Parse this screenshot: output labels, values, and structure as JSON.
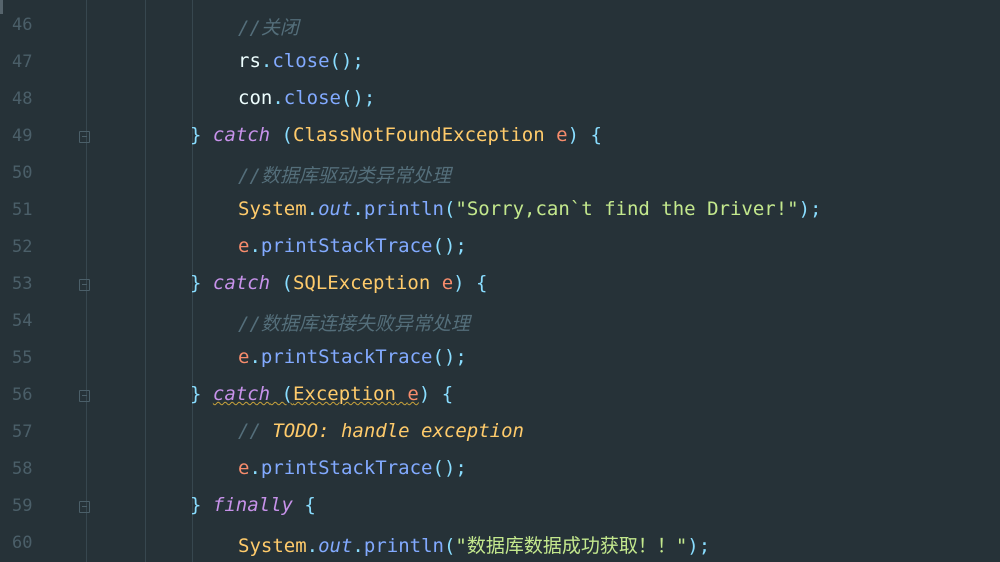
{
  "editor": {
    "lines": [
      {
        "num": "46",
        "indent": 2,
        "tokens": [
          {
            "t": "comment",
            "v": "//关闭"
          }
        ]
      },
      {
        "num": "47",
        "indent": 2,
        "tokens": [
          {
            "t": "plain",
            "v": "rs"
          },
          {
            "t": "punc",
            "v": "."
          },
          {
            "t": "method",
            "v": "close"
          },
          {
            "t": "punc",
            "v": "();"
          }
        ]
      },
      {
        "num": "48",
        "indent": 2,
        "tokens": [
          {
            "t": "plain",
            "v": "con"
          },
          {
            "t": "punc",
            "v": "."
          },
          {
            "t": "method",
            "v": "close"
          },
          {
            "t": "punc",
            "v": "();"
          }
        ]
      },
      {
        "num": "49",
        "indent": 1,
        "fold": true,
        "tokens": [
          {
            "t": "punc",
            "v": "} "
          },
          {
            "t": "kw",
            "v": "catch"
          },
          {
            "t": "punc",
            "v": " ("
          },
          {
            "t": "cls",
            "v": "ClassNotFoundException"
          },
          {
            "t": "plain",
            "v": " "
          },
          {
            "t": "param",
            "v": "e"
          },
          {
            "t": "punc",
            "v": ") {"
          }
        ]
      },
      {
        "num": "50",
        "indent": 2,
        "tokens": [
          {
            "t": "comment",
            "v": "//数据库驱动类异常处理"
          }
        ]
      },
      {
        "num": "51",
        "indent": 2,
        "tokens": [
          {
            "t": "cls",
            "v": "System"
          },
          {
            "t": "punc",
            "v": "."
          },
          {
            "t": "field",
            "v": "out"
          },
          {
            "t": "punc",
            "v": "."
          },
          {
            "t": "method",
            "v": "println"
          },
          {
            "t": "punc",
            "v": "("
          },
          {
            "t": "str",
            "v": "\"Sorry,can`t find the Driver!\""
          },
          {
            "t": "punc",
            "v": ");"
          }
        ]
      },
      {
        "num": "52",
        "indent": 2,
        "tokens": [
          {
            "t": "param",
            "v": "e"
          },
          {
            "t": "punc",
            "v": "."
          },
          {
            "t": "method",
            "v": "printStackTrace"
          },
          {
            "t": "punc",
            "v": "();"
          }
        ]
      },
      {
        "num": "53",
        "indent": 1,
        "fold": true,
        "tokens": [
          {
            "t": "punc",
            "v": "} "
          },
          {
            "t": "kw",
            "v": "catch"
          },
          {
            "t": "punc",
            "v": " ("
          },
          {
            "t": "cls",
            "v": "SQLException"
          },
          {
            "t": "plain",
            "v": " "
          },
          {
            "t": "param",
            "v": "e"
          },
          {
            "t": "punc",
            "v": ") {"
          }
        ]
      },
      {
        "num": "54",
        "indent": 2,
        "tokens": [
          {
            "t": "comment",
            "v": "//数据库连接失败异常处理"
          }
        ]
      },
      {
        "num": "55",
        "indent": 2,
        "tokens": [
          {
            "t": "param",
            "v": "e"
          },
          {
            "t": "punc",
            "v": "."
          },
          {
            "t": "method",
            "v": "printStackTrace"
          },
          {
            "t": "punc",
            "v": "();"
          }
        ]
      },
      {
        "num": "56",
        "indent": 1,
        "fold": true,
        "tokens": [
          {
            "t": "punc",
            "v": "} "
          },
          {
            "t": "kw wavy",
            "v": "catch"
          },
          {
            "t": "punc wavy",
            "v": " ("
          },
          {
            "t": "cls wavy",
            "v": "Exception"
          },
          {
            "t": "plain wavy",
            "v": " "
          },
          {
            "t": "param wavy",
            "v": "e"
          },
          {
            "t": "punc",
            "v": ") {"
          }
        ]
      },
      {
        "num": "57",
        "indent": 2,
        "tokens": [
          {
            "t": "comment",
            "v": "// "
          },
          {
            "t": "todo",
            "v": "TODO: handle exception"
          }
        ]
      },
      {
        "num": "58",
        "indent": 2,
        "tokens": [
          {
            "t": "param",
            "v": "e"
          },
          {
            "t": "punc",
            "v": "."
          },
          {
            "t": "method",
            "v": "printStackTrace"
          },
          {
            "t": "punc",
            "v": "();"
          }
        ]
      },
      {
        "num": "59",
        "indent": 1,
        "fold": true,
        "tokens": [
          {
            "t": "punc",
            "v": "} "
          },
          {
            "t": "kw",
            "v": "finally"
          },
          {
            "t": "punc",
            "v": " {"
          }
        ]
      },
      {
        "num": "60",
        "indent": 2,
        "tokens": [
          {
            "t": "cls",
            "v": "System"
          },
          {
            "t": "punc",
            "v": "."
          },
          {
            "t": "field",
            "v": "out"
          },
          {
            "t": "punc",
            "v": "."
          },
          {
            "t": "method",
            "v": "println"
          },
          {
            "t": "punc",
            "v": "("
          },
          {
            "t": "str",
            "v": "\"数据库数据成功获取！！\""
          },
          {
            "t": "punc",
            "v": ");"
          }
        ]
      }
    ]
  },
  "colors": {
    "background": "#263238",
    "keyword": "#c792ea",
    "class": "#ffcb6b",
    "method": "#82aaff",
    "param": "#f78c6c",
    "string": "#c3e88d",
    "comment": "#546e7a",
    "line_number": "#4b5f69"
  },
  "icons": {
    "fold": "fold-marker-icon"
  }
}
